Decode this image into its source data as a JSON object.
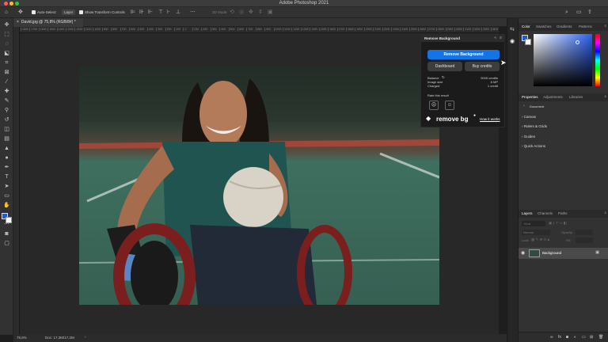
{
  "window": {
    "title": "Adobe Photoshop 2021"
  },
  "options_bar": {
    "auto_select_label": "Auto-Select:",
    "auto_select_value": "Layer",
    "show_transform_label": "Show Transform Controls",
    "mode_3d_label": "3D Mode:"
  },
  "document": {
    "tab_label": "David.jpg @ 75,8% (RGB/8#) *",
    "zoom": "75,8%",
    "doc_info": "Doc: 17,3M/17,2M"
  },
  "ruler": {
    "ticks": [
      "1800",
      "1700",
      "1600",
      "1500",
      "1400",
      "1300",
      "1200",
      "1100",
      "1000",
      "900",
      "800",
      "700",
      "600",
      "500",
      "400",
      "300",
      "200",
      "100",
      "0",
      "100",
      "200",
      "300",
      "400",
      "500",
      "600",
      "700",
      "800",
      "900",
      "1000",
      "1100",
      "1200",
      "1300",
      "1400",
      "1500",
      "1600",
      "1700",
      "1800",
      "1900",
      "2000",
      "2100",
      "2200",
      "2300",
      "2400",
      "2500",
      "2600",
      "2700",
      "2800",
      "2900",
      "3000",
      "3100",
      "3200",
      "3300",
      "3400"
    ]
  },
  "plugin": {
    "header": "Remove Background",
    "primary_button": "Remove Background",
    "dashboard_button": "Dashboard",
    "buy_credits_button": "Buy credits",
    "balance_label": "Balance",
    "balance_value": "9005 credits",
    "image_size_label": "Image size",
    "image_size_value": "8 MP",
    "charged_label": "Charged",
    "charged_value": "1 credit",
    "rate_label": "Rate this result",
    "logo_text": "remove bg",
    "how_it_works": "How it works"
  },
  "color_panel": {
    "tabs": [
      "Color",
      "Swatches",
      "Gradients",
      "Patterns"
    ],
    "active": 0
  },
  "properties_panel": {
    "tabs": [
      "Properties",
      "Adjustments",
      "Libraries"
    ],
    "active": 0,
    "document_label": "Document",
    "sections": [
      "Canvas",
      "Rulers & Grids",
      "Guides",
      "Quick Actions"
    ]
  },
  "layers_panel": {
    "tabs": [
      "Layers",
      "Channels",
      "Paths"
    ],
    "active": 0,
    "search_placeholder": "Kind",
    "blend_mode": "Normal",
    "opacity_label": "Opacity:",
    "lock_label": "Lock:",
    "fill_label": "Fill:",
    "layers": [
      {
        "name": "Background",
        "visible": true,
        "locked": true
      }
    ]
  },
  "colors": {
    "accent": "#1473e6",
    "foreground_swatch": "#1e5bd6",
    "background_swatch": "#ffffff"
  }
}
